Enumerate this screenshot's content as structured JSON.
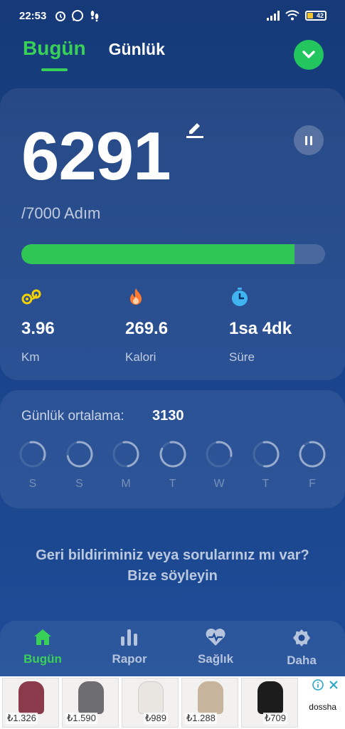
{
  "status_bar": {
    "time": "22:53",
    "battery_level": "42"
  },
  "header": {
    "tabs": [
      {
        "label": "Bugün",
        "active": true
      },
      {
        "label": "Günlük",
        "active": false
      }
    ]
  },
  "main_card": {
    "steps": "6291",
    "goal_text": "/7000 Adım",
    "progress_fraction": 0.899,
    "stats": [
      {
        "icon": "distance-icon",
        "value": "3.96",
        "label": "Km",
        "color": "#f5d000"
      },
      {
        "icon": "flame-icon",
        "value": "269.6",
        "label": "Kalori",
        "color": "#ff7a2f"
      },
      {
        "icon": "stopwatch-icon",
        "value": "1sa 4dk",
        "label": "Süre",
        "color": "#3fb4f0"
      }
    ]
  },
  "average_card": {
    "label": "Günlük ortalama:",
    "value": "3130",
    "days": [
      {
        "label": "S",
        "progress": 0.35
      },
      {
        "label": "S",
        "progress": 0.75
      },
      {
        "label": "M",
        "progress": 0.5
      },
      {
        "label": "T",
        "progress": 0.85
      },
      {
        "label": "W",
        "progress": 0.3
      },
      {
        "label": "T",
        "progress": 0.55
      },
      {
        "label": "F",
        "progress": 0.9
      }
    ]
  },
  "feedback": {
    "line1": "Geri bildiriminiz veya sorularınız mı var?",
    "line2": "Bize söyleyin"
  },
  "bottom_nav": {
    "items": [
      {
        "label": "Bugün",
        "icon": "home-icon",
        "active": true
      },
      {
        "label": "Rapor",
        "icon": "bar-chart-icon",
        "active": false
      },
      {
        "label": "Sağlık",
        "icon": "heart-pulse-icon",
        "active": false
      },
      {
        "label": "Daha",
        "icon": "gear-icon",
        "active": false
      }
    ]
  },
  "ad_banner": {
    "products": [
      {
        "price": "₺1.326",
        "color": "#8a3a4a"
      },
      {
        "price": "₺1.590",
        "color": "#6d6d72"
      },
      {
        "price": "₺989",
        "color": "#e9e6e2"
      },
      {
        "price": "₺1.288",
        "color": "#c7b49d"
      },
      {
        "price": "₺709",
        "color": "#1c1c1c"
      }
    ],
    "brand": "dossha"
  },
  "colors": {
    "accent": "#39d058",
    "background": "#1a438a"
  }
}
